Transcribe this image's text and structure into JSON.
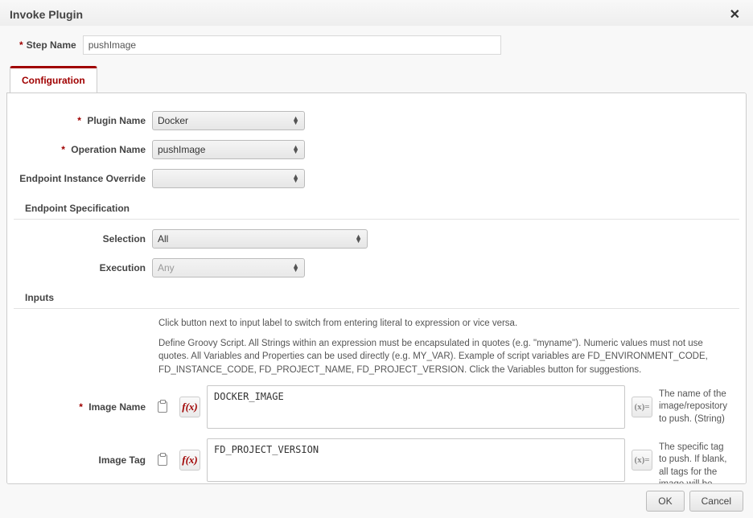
{
  "dialog": {
    "title": "Invoke Plugin",
    "close": "✕",
    "step_name_label": "Step Name",
    "step_name_value": "pushImage"
  },
  "tabs": {
    "configuration": "Configuration"
  },
  "form": {
    "plugin_name_label": "Plugin Name",
    "plugin_name_value": "Docker",
    "operation_name_label": "Operation Name",
    "operation_name_value": "pushImage",
    "endpoint_override_label": "Endpoint Instance Override",
    "endpoint_override_value": ""
  },
  "endpoint": {
    "section": "Endpoint Specification",
    "selection_label": "Selection",
    "selection_value": "All",
    "execution_label": "Execution",
    "execution_value": "Any"
  },
  "inputs": {
    "section": "Inputs",
    "help1": "Click button next to input label to switch from entering literal to expression or vice versa.",
    "help2": "Define Groovy Script. All Strings within an expression must be encapsulated in quotes (e.g. \"myname\"). Numeric values must not use quotes. All Variables and Properties can be used directly (e.g. MY_VAR). Example of script variables are FD_ENVIRONMENT_CODE, FD_INSTANCE_CODE, FD_PROJECT_NAME, FD_PROJECT_VERSION. Click the Variables button for suggestions.",
    "image_name_label": "Image Name",
    "image_name_value": "DOCKER_IMAGE",
    "image_name_desc": "The name of the image/repository to push. (String)",
    "image_tag_label": "Image Tag",
    "image_tag_value": "FD_PROJECT_VERSION",
    "image_tag_desc": "The specific tag to push. If blank, all tags for the image will be pushed. (String)"
  },
  "footer": {
    "ok": "OK",
    "cancel": "Cancel"
  },
  "icons": {
    "fx": "f(x)",
    "varx": "(x)="
  }
}
